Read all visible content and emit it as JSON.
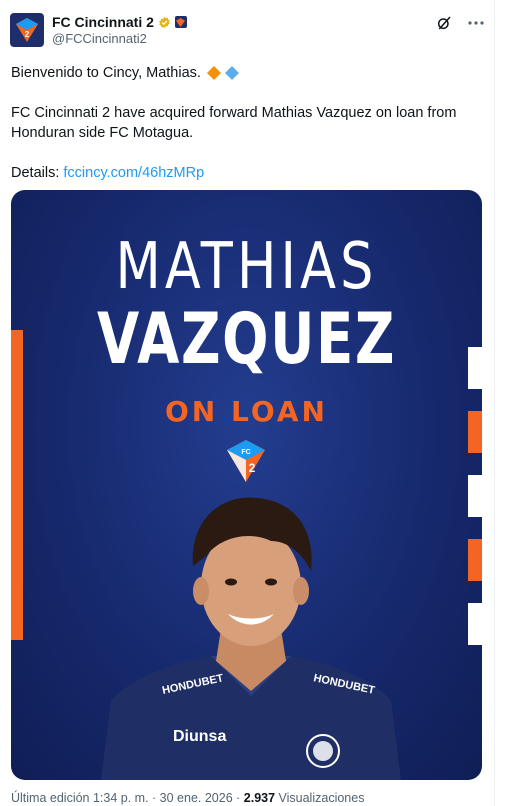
{
  "account": {
    "name": "FC Cincinnati 2",
    "handle": "@FCCincinnati2"
  },
  "tweet": {
    "line1": "Bienvenido to Cincy, Mathias.",
    "line2": "FC Cincinnati 2 have acquired forward Mathias Vazquez on loan from Honduran side FC Motagua.",
    "details_label": "Details:",
    "details_link": "fccincy.com/46hzMRp"
  },
  "graphic": {
    "first_name": "MATHIAS",
    "last_name": "VAZQUEZ",
    "status": "ON LOAN",
    "crest_text": "FC",
    "crest_number": "2",
    "sponsor_left": "HONDUBET",
    "sponsor_right": "HONDUBET",
    "jersey_sponsor": "Diunsa"
  },
  "footer": {
    "edited": "Última edición 1:34 p. m. · 30 ene. 2026 · ",
    "views": "2.937",
    "views_label": " Visualizaciones"
  },
  "colors": {
    "brand_blue": "#1d2e6b",
    "brand_orange": "#f26522",
    "link": "#1d9bf0"
  }
}
